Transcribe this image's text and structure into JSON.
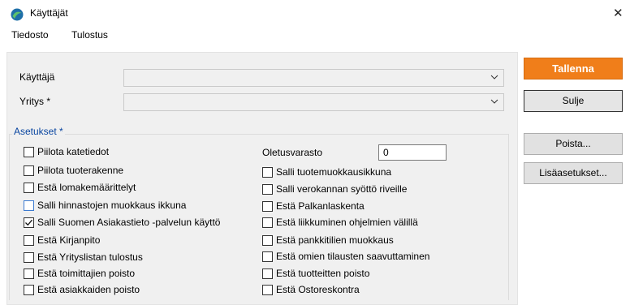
{
  "window": {
    "title": "Käyttäjät"
  },
  "menu": {
    "items": [
      "Tiedosto",
      "Tulostus"
    ]
  },
  "form": {
    "user_label": "Käyttäjä",
    "user_value": "",
    "company_label": "Yritys *",
    "company_value": ""
  },
  "settings": {
    "legend": "Asetukset *",
    "left": [
      {
        "label": "Piilota katetiedot",
        "checked": false
      },
      {
        "label": "Piilota tuoterakenne",
        "checked": false
      },
      {
        "label": "Estä lomakemäärittelyt",
        "checked": false
      },
      {
        "label": "Salli hinnastojen muokkaus ikkuna",
        "checked": false
      },
      {
        "label": "Salli Suomen Asiakastieto -palvelun käyttö",
        "checked": true
      },
      {
        "label": "Estä Kirjanpito",
        "checked": false
      },
      {
        "label": "Estä Yrityslistan tulostus",
        "checked": false
      },
      {
        "label": "Estä toimittajien poisto",
        "checked": false
      },
      {
        "label": "Estä asiakkaiden poisto",
        "checked": false
      }
    ],
    "warehouse_label": "Oletusvarasto",
    "warehouse_value": "0",
    "right": [
      {
        "label": "Salli tuotemuokkausikkuna",
        "checked": false
      },
      {
        "label": "Salli verokannan syöttö riveille",
        "checked": false
      },
      {
        "label": "Estä Palkanlaskenta",
        "checked": false
      },
      {
        "label": "Estä liikkuminen ohjelmien välillä",
        "checked": false
      },
      {
        "label": "Estä pankkitilien muokkaus",
        "checked": false
      },
      {
        "label": "Estä omien tilausten saavuttaminen",
        "checked": false
      },
      {
        "label": "Estä tuotteitten poisto",
        "checked": false
      },
      {
        "label": "Estä Ostoreskontra",
        "checked": false
      }
    ]
  },
  "buttons": {
    "save": "Tallenna",
    "close": "Sulje",
    "delete": "Poista...",
    "more": "Lisäasetukset..."
  },
  "colors": {
    "primary": "#f07e1a",
    "legend": "#0a46a0"
  }
}
